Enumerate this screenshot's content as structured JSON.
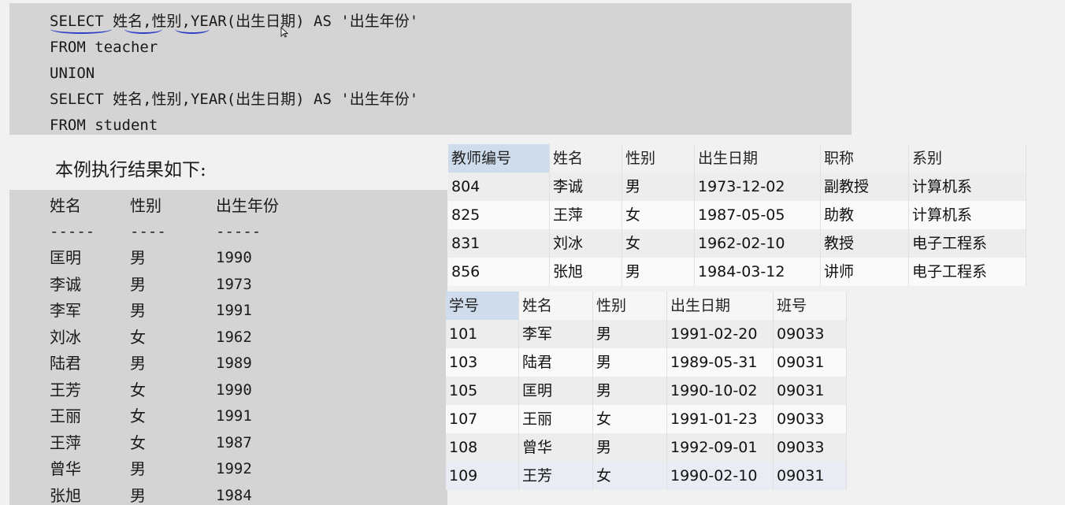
{
  "code": {
    "lines": [
      "SELECT 姓名,性别,YEAR(出生日期) AS '出生年份'",
      "FROM teacher",
      "UNION",
      "SELECT 姓名,性别,YEAR(出生日期) AS '出生年份'",
      "FROM student"
    ]
  },
  "caption": "本例执行结果如下:",
  "result": {
    "headers": [
      "姓名",
      "性别",
      "出生年份"
    ],
    "separators": [
      "-----",
      "----",
      "-----"
    ],
    "rows": [
      [
        "匡明",
        "男",
        "1990"
      ],
      [
        "李诚",
        "男",
        "1973"
      ],
      [
        "李军",
        "男",
        "1991"
      ],
      [
        "刘冰",
        "女",
        "1962"
      ],
      [
        "陆君",
        "男",
        "1989"
      ],
      [
        "王芳",
        "女",
        "1990"
      ],
      [
        "王丽",
        "女",
        "1991"
      ],
      [
        "王萍",
        "女",
        "1987"
      ],
      [
        "曾华",
        "男",
        "1992"
      ],
      [
        "张旭",
        "男",
        "1984"
      ]
    ]
  },
  "teacher_table": {
    "headers": [
      "教师编号",
      "姓名",
      "性别",
      "出生日期",
      "职称",
      "系别"
    ],
    "rows": [
      [
        "804",
        "李诚",
        "男",
        "1973-12-02",
        "副教授",
        "计算机系"
      ],
      [
        "825",
        "王萍",
        "女",
        "1987-05-05",
        "助教",
        "计算机系"
      ],
      [
        "831",
        "刘冰",
        "女",
        "1962-02-10",
        "教授",
        "电子工程系"
      ],
      [
        "856",
        "张旭",
        "男",
        "1984-03-12",
        "讲师",
        "电子工程系"
      ]
    ]
  },
  "student_table": {
    "headers": [
      "学号",
      "姓名",
      "性别",
      "出生日期",
      "班号"
    ],
    "rows": [
      [
        "101",
        "李军",
        "男",
        "1991-02-20",
        "09033"
      ],
      [
        "103",
        "陆君",
        "男",
        "1989-05-31",
        "09031"
      ],
      [
        "105",
        "匡明",
        "男",
        "1990-10-02",
        "09031"
      ],
      [
        "107",
        "王丽",
        "女",
        "1991-01-23",
        "09033"
      ],
      [
        "108",
        "曾华",
        "男",
        "1992-09-01",
        "09033"
      ],
      [
        "109",
        "王芳",
        "女",
        "1990-02-10",
        "09031"
      ]
    ]
  },
  "colors": {
    "code_bg": "#d4d4d4",
    "header_highlight": "#cfdcec",
    "pen_mark": "#2a3fc4"
  },
  "icons": {
    "cursor": "mouse-pointer-icon"
  }
}
